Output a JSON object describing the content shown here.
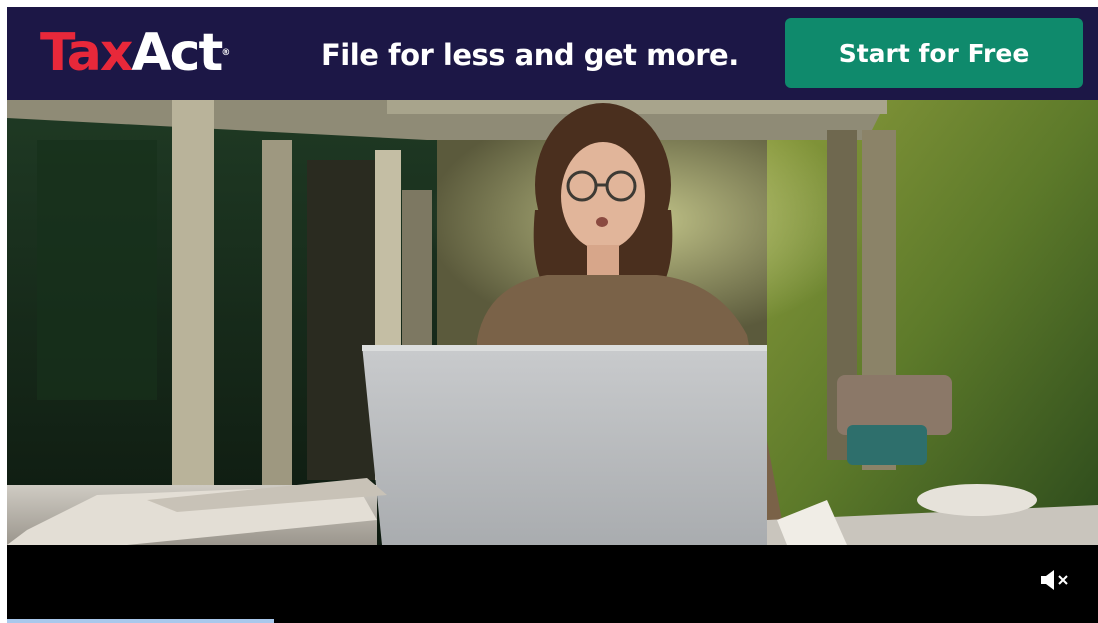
{
  "banner": {
    "logo_part1": "Tax",
    "logo_part2": "Act",
    "logo_mark": "®",
    "tagline": "File for less and get more.",
    "cta_label": "Start for Free",
    "colors": {
      "background": "#1c1746",
      "logo_red": "#e8283a",
      "cta": "#0f8a6c"
    }
  },
  "video": {
    "muted": true,
    "mute_icon": "speaker-muted-icon",
    "progress": 0.245,
    "progress_color": "#a9c8ec"
  }
}
